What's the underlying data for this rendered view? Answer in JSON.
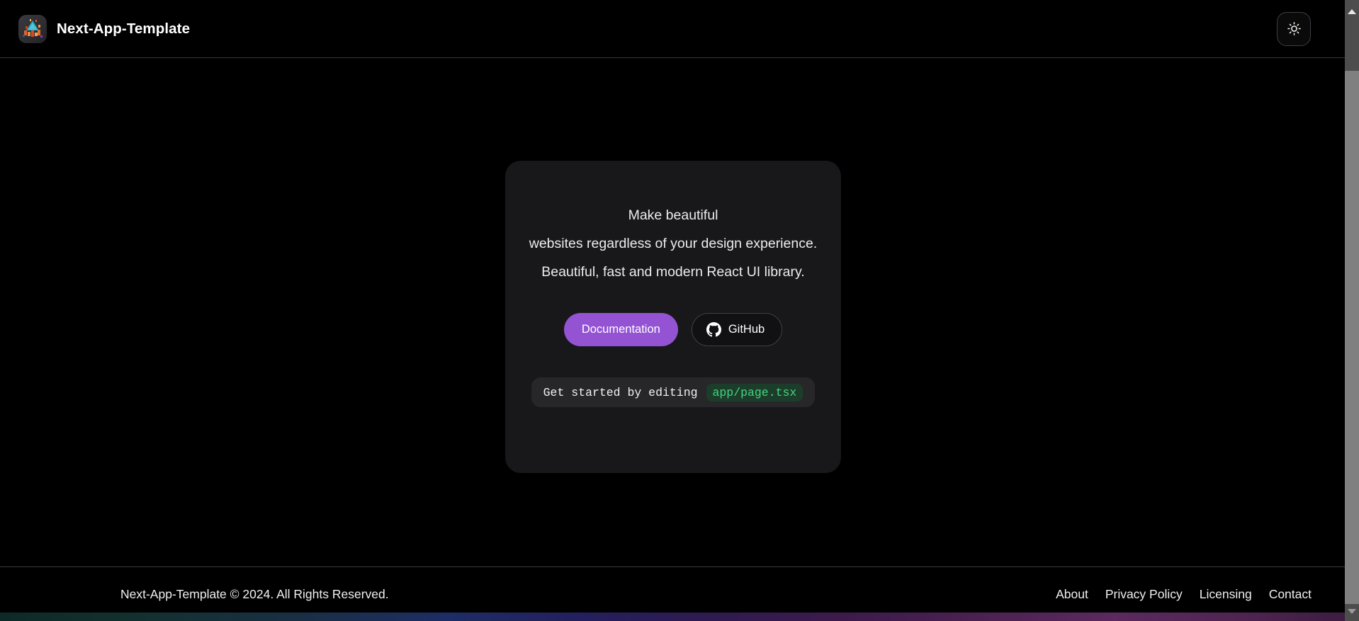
{
  "navbar": {
    "brand_title": "Next-App-Template",
    "logo_icon": "app-logo-icon",
    "theme_toggle_icon": "sun-icon"
  },
  "hero": {
    "lines": [
      "Make beautiful",
      "websites regardless of your design experience.",
      "Beautiful, fast and modern React UI library."
    ],
    "buttons": {
      "documentation_label": "Documentation",
      "github_label": "GitHub",
      "github_icon": "github-icon"
    },
    "snippet": {
      "text": "Get started by editing",
      "code": "app/page.tsx"
    }
  },
  "footer": {
    "copyright": "Next-App-Template © 2024. All Rights Reserved.",
    "links": [
      {
        "label": "About"
      },
      {
        "label": "Privacy Policy"
      },
      {
        "label": "Licensing"
      },
      {
        "label": "Contact"
      }
    ]
  },
  "colors": {
    "page_background": "#000000",
    "card_background": "#18181b",
    "primary_accent": "#9353d3",
    "code_green": "#45d483",
    "code_chip_background": "#1b3d2a",
    "border": "#3f3f46",
    "snippet_background": "#27272a"
  }
}
